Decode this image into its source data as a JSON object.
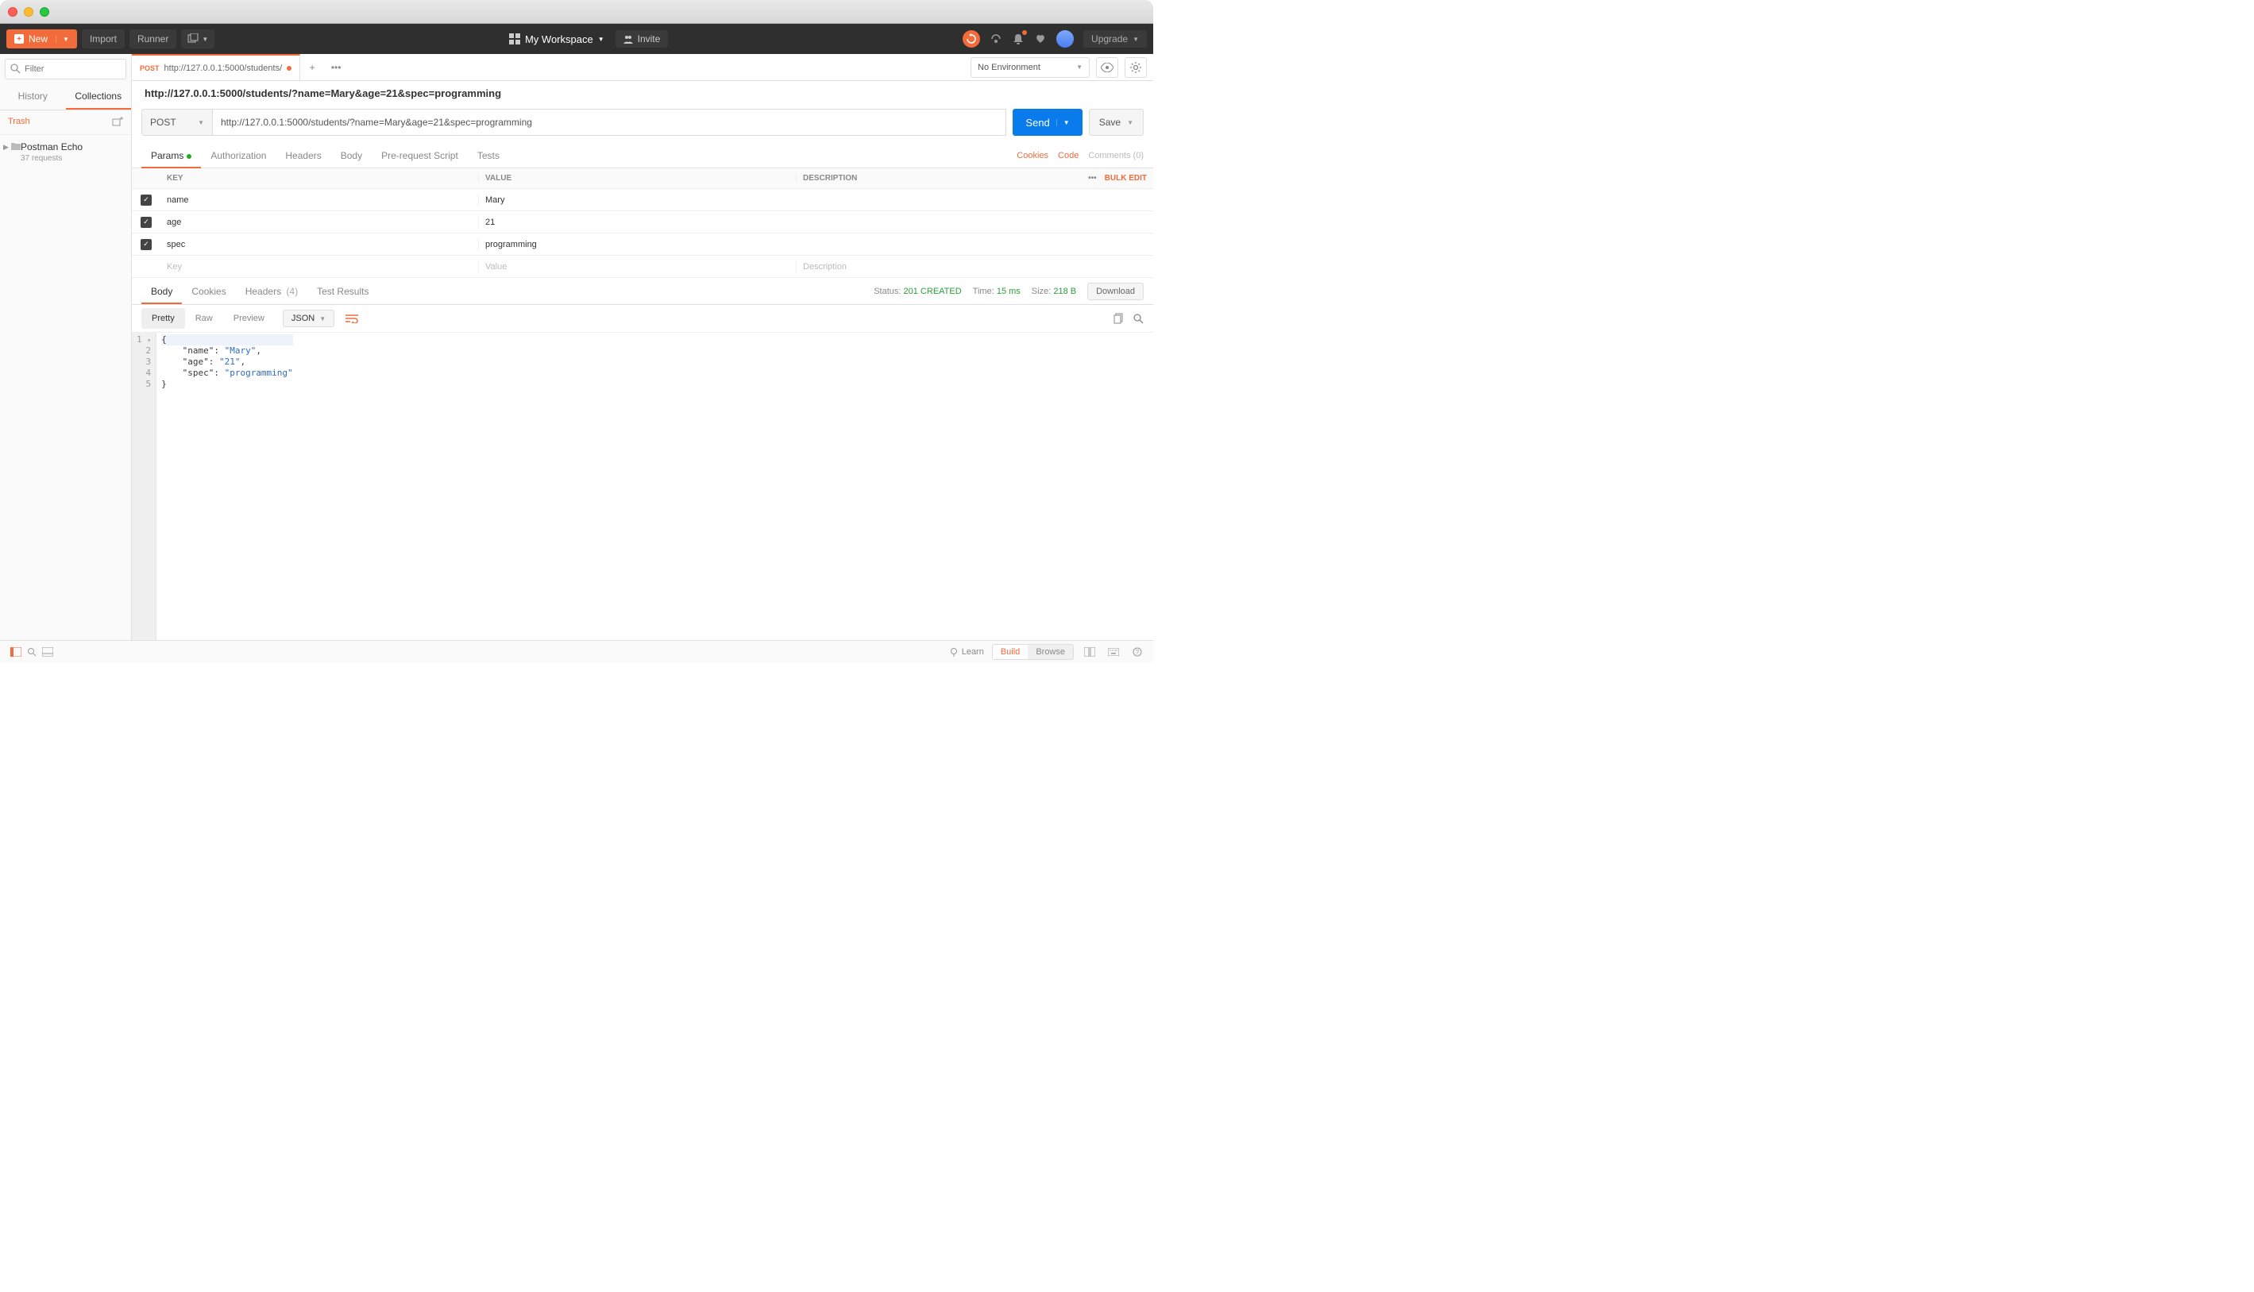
{
  "topbar": {
    "new_label": "New",
    "import_label": "Import",
    "runner_label": "Runner",
    "workspace_label": "My Workspace",
    "invite_label": "Invite",
    "upgrade_label": "Upgrade"
  },
  "sidebar": {
    "filter_placeholder": "Filter",
    "tabs": {
      "history": "History",
      "collections": "Collections"
    },
    "trash_label": "Trash",
    "collection": {
      "name": "Postman Echo",
      "sub": "37 requests"
    }
  },
  "tabrow": {
    "tab_method": "POST",
    "tab_url": "http://127.0.0.1:5000/students/",
    "env_label": "No Environment"
  },
  "request": {
    "name": "http://127.0.0.1:5000/students/?name=Mary&age=21&spec=programming",
    "method": "POST",
    "url": "http://127.0.0.1:5000/students/?name=Mary&age=21&spec=programming",
    "send_label": "Send",
    "save_label": "Save"
  },
  "request_tabs": {
    "params": "Params",
    "authorization": "Authorization",
    "headers": "Headers",
    "body": "Body",
    "prerequest": "Pre-request Script",
    "tests": "Tests",
    "cookies": "Cookies",
    "code": "Code",
    "comments": "Comments (0)"
  },
  "params": {
    "head_key": "KEY",
    "head_value": "VALUE",
    "head_desc": "DESCRIPTION",
    "bulk_edit": "Bulk Edit",
    "rows": [
      {
        "key": "name",
        "value": "Mary"
      },
      {
        "key": "age",
        "value": "21"
      },
      {
        "key": "spec",
        "value": "programming"
      }
    ],
    "key_placeholder": "Key",
    "value_placeholder": "Value",
    "desc_placeholder": "Description"
  },
  "response_tabs": {
    "body": "Body",
    "cookies": "Cookies",
    "headers": "Headers",
    "headers_count": "(4)",
    "tests": "Test Results"
  },
  "response_meta": {
    "status_label": "Status:",
    "status_value": "201 CREATED",
    "time_label": "Time:",
    "time_value": "15 ms",
    "size_label": "Size:",
    "size_value": "218 B",
    "download": "Download"
  },
  "view": {
    "pretty": "Pretty",
    "raw": "Raw",
    "preview": "Preview",
    "format": "JSON"
  },
  "response_body": {
    "line1": "{",
    "line2_key": "\"name\"",
    "line2_val": "\"Mary\"",
    "line3_key": "\"age\"",
    "line3_val": "\"21\"",
    "line4_key": "\"spec\"",
    "line4_val": "\"programming\"",
    "line5": "}"
  },
  "statusbar": {
    "learn": "Learn",
    "build": "Build",
    "browse": "Browse"
  }
}
